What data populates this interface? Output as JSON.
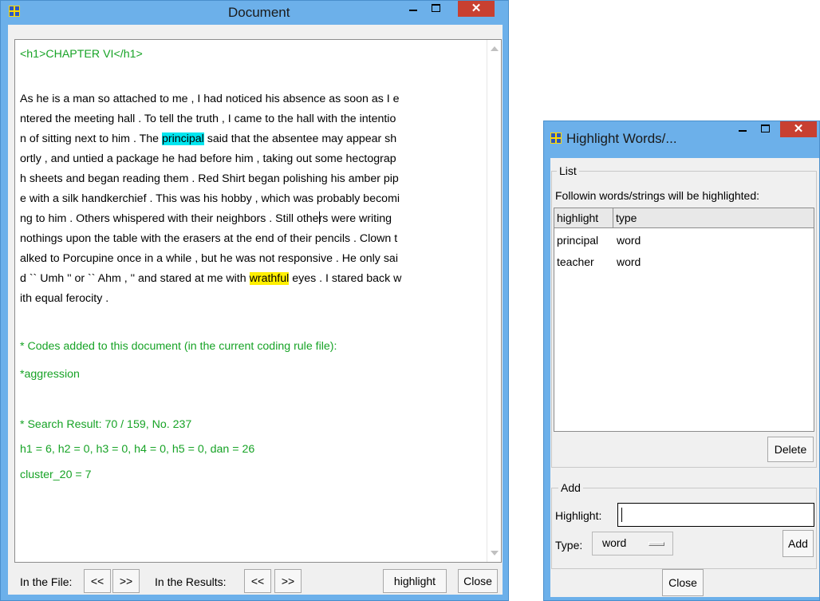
{
  "doc_window": {
    "title": "Document",
    "close_glyph": "✕",
    "lines": [
      {
        "segments": [
          {
            "text": "<h1>CHAPTER VI</h1>",
            "style": "green"
          }
        ]
      },
      {
        "segments": []
      },
      {
        "segments": [
          {
            "text": " As he is a man so attached to me , I had noticed his absence as soon as I e"
          }
        ]
      },
      {
        "segments": [
          {
            "text": "ntered the meeting hall . To tell the truth , I came to the hall with the intentio"
          }
        ]
      },
      {
        "segments": [
          {
            "text": "n of sitting next to him . The "
          },
          {
            "text": "principal",
            "style": "hl-cyan"
          },
          {
            "text": " said that the absentee may appear sh"
          }
        ]
      },
      {
        "segments": [
          {
            "text": "ortly , and untied a package he had before him , taking out some hectograp"
          }
        ]
      },
      {
        "segments": [
          {
            "text": "h sheets and began reading them . Red Shirt began polishing his amber pip"
          }
        ]
      },
      {
        "segments": [
          {
            "text": "e with a silk handkerchief . This was his hobby , which was probably becomi"
          }
        ]
      },
      {
        "segments": [
          {
            "text": "ng to him . Others whispered with their neighbors . Still othe"
          },
          {
            "text": "",
            "style": "caret"
          },
          {
            "text": "rs were writing"
          }
        ]
      },
      {
        "segments": [
          {
            "text": "nothings upon the table with the erasers at the end of their pencils . Clown t"
          }
        ]
      },
      {
        "segments": [
          {
            "text": "alked to Porcupine once in a while , but he was not responsive . He only sai"
          }
        ]
      },
      {
        "segments": [
          {
            "text": "d `` Umh '' or `` Ahm , '' and stared at me with "
          },
          {
            "text": "wrathful",
            "style": "hl-yellow"
          },
          {
            "text": " eyes . I stared back w"
          }
        ]
      },
      {
        "segments": [
          {
            "text": "ith equal ferocity ."
          }
        ]
      },
      {
        "segments": []
      },
      {
        "segments": []
      },
      {
        "segments": [
          {
            "text": "* Codes added to this document (in the current coding rule file):",
            "style": "green"
          }
        ]
      },
      {
        "segments": []
      },
      {
        "segments": [
          {
            "text": "    *aggression",
            "style": "green"
          }
        ]
      },
      {
        "segments": []
      },
      {
        "segments": []
      },
      {
        "segments": [
          {
            "text": "* Search Result: 70 / 159,  No. 237",
            "style": "green"
          }
        ]
      },
      {
        "segments": []
      },
      {
        "segments": [
          {
            "text": "  h1 = 6,  h2 = 0,  h3 = 0,  h4 = 0,  h5 = 0,  dan = 26",
            "style": "green"
          }
        ]
      },
      {
        "segments": []
      },
      {
        "segments": [
          {
            "text": "  cluster_20 = 7",
            "style": "green"
          }
        ]
      }
    ],
    "toolbar": {
      "in_file_label": "In the File:",
      "prev_label": "<<",
      "next_label": ">>",
      "in_results_label": "In the Results:",
      "results_prev_label": "<<",
      "results_next_label": ">>",
      "highlight_label": "highlight",
      "close_label": "Close"
    }
  },
  "hl_window": {
    "title": "Highlight Words/...",
    "close_glyph": "✕",
    "list_group": "List",
    "list_caption": "Followin words/strings will be highlighted:",
    "columns": [
      "highlight",
      "type"
    ],
    "rows": [
      {
        "highlight": "principal",
        "type": "word"
      },
      {
        "highlight": "teacher",
        "type": "word"
      }
    ],
    "delete_label": "Delete",
    "add_group": "Add",
    "highlight_label": "Highlight:",
    "highlight_value": "",
    "type_label": "Type:",
    "type_value": "word",
    "add_label": "Add",
    "close_label": "Close"
  },
  "colors": {
    "titlebar": "#6cb0ea",
    "close_button": "#c84031",
    "green_text": "#17a326",
    "highlight_cyan": "#00e6f0",
    "highlight_yellow": "#ffef00"
  }
}
